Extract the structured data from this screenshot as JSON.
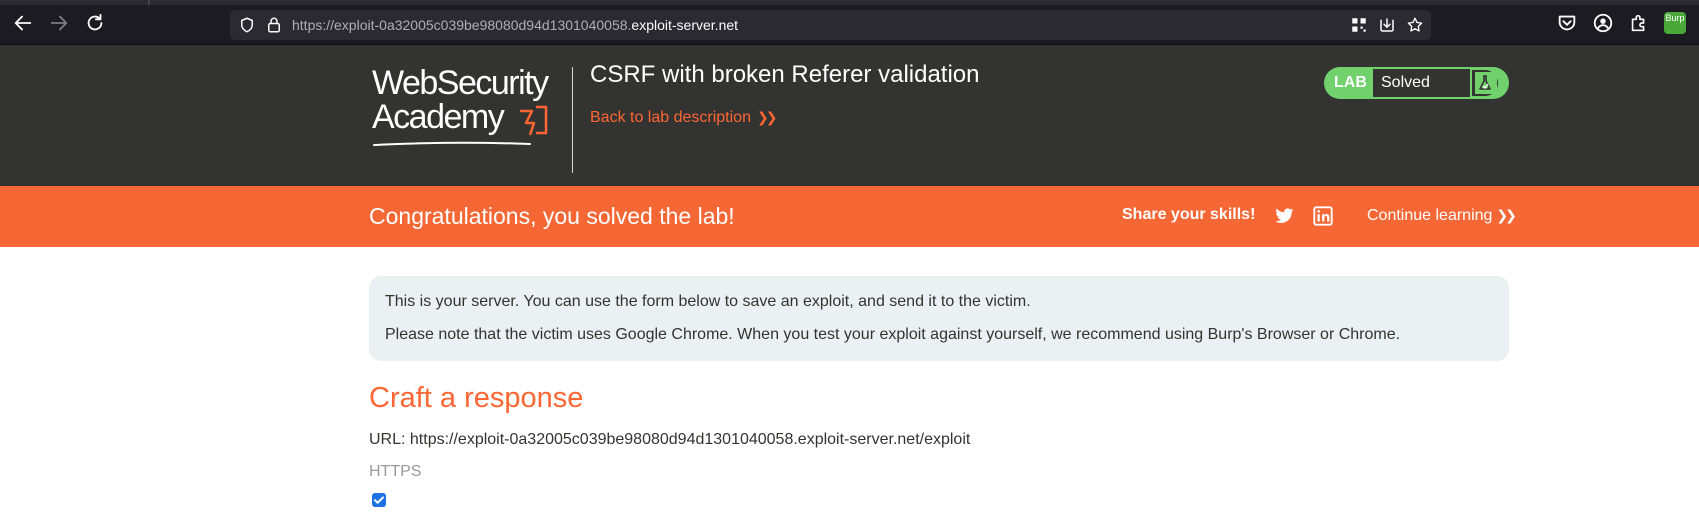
{
  "browser": {
    "url_prefix": "https://exploit-0a32005c039be98080d94d1301040058.",
    "url_host": "exploit-server.net",
    "burp_ext_label": "Burp"
  },
  "header": {
    "logo_line1": "WebSecurity",
    "logo_line2": "Academy",
    "title": "CSRF with broken Referer validation",
    "back_link": "Back to lab description",
    "lab_tag": "LAB",
    "lab_status": "Solved"
  },
  "banner": {
    "message": "Congratulations, you solved the lab!",
    "share_label": "Share your skills!",
    "continue_link": "Continue learning"
  },
  "info": {
    "line1": "This is your server. You can use the form below to save an exploit, and send it to the victim.",
    "line2": "Please note that the victim uses Google Chrome. When you test your exploit against yourself, we recommend using Burp's Browser or Chrome."
  },
  "form": {
    "title": "Craft a response",
    "url_line": "URL: https://exploit-0a32005c039be98080d94d1301040058.exploit-server.net/exploit",
    "https_label": "HTTPS",
    "https_checked": true
  },
  "colors": {
    "accent": "#ff6633",
    "banner": "#f56836",
    "header_bg": "#333332",
    "solved_green": "#70d16d",
    "info_bg": "#ebf0f2"
  },
  "icons": {
    "back": "arrow-left-icon",
    "forward": "arrow-right-icon",
    "reload": "reload-icon",
    "shield": "shield-icon",
    "lock": "lock-icon",
    "grid": "qr-grid-icon",
    "save_to_pocket": "tray-download-icon",
    "bookmark": "star-icon",
    "pocket": "pocket-icon",
    "account": "account-icon",
    "extensions": "puzzle-icon",
    "twitter": "twitter-icon",
    "linkedin": "linkedin-icon",
    "flask": "flask-icon"
  }
}
